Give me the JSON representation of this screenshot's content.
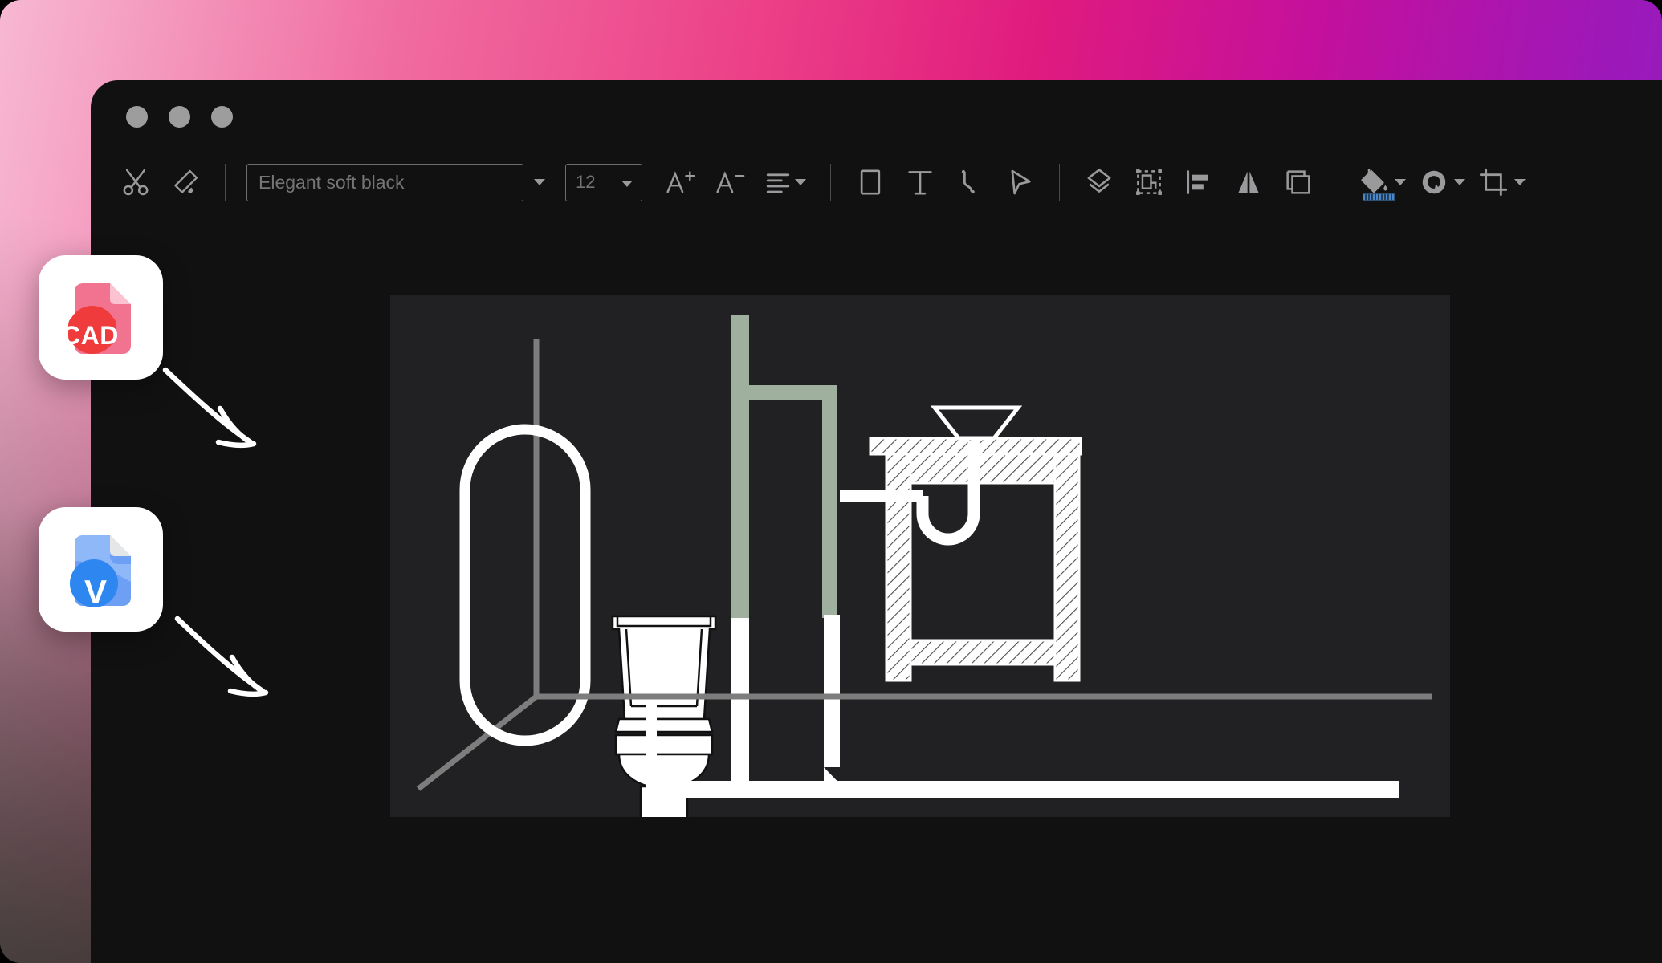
{
  "window": {
    "traffic_lights": [
      "close",
      "minimize",
      "maximize"
    ]
  },
  "toolbar": {
    "cut_label": "Cut",
    "format_painter_label": "Format Painter",
    "font_name": "Elegant soft black",
    "font_name_placeholder": "Elegant soft black",
    "font_name_dropdown_label": "Font list",
    "font_size": "12",
    "font_size_placeholder": "12",
    "font_size_dropdown_label": "Size list",
    "increase_font_label": "Increase font size",
    "decrease_font_label": "Decrease font size",
    "align_label": "Text alignment",
    "rectangle_label": "Rectangle",
    "text_label": "Text",
    "polyline_label": "Polyline",
    "select_label": "Select",
    "layers_label": "Layers",
    "group_label": "Group objects",
    "align_left_label": "Align left",
    "mirror_label": "Mirror",
    "frame_label": "Frame",
    "fill_label": "Fill color",
    "shape_fill_label": "Shape fill",
    "crop_label": "Crop",
    "fill_swatch_color": "#4a86c8",
    "icon_color": "#9a9a9c"
  },
  "cards": [
    {
      "name": "cad-file",
      "badge_text": "CAD",
      "doc_color": "#f2738f",
      "doc_color_light": "#f8b7c6",
      "badge_color": "#ef3b3b",
      "card_background": "#ffffff"
    },
    {
      "name": "visio-file",
      "badge_text": "V",
      "doc_color": "#6d9ff5",
      "doc_color_light": "#a9c7fb",
      "badge_color": "#2e86f0",
      "card_background": "#ffffff"
    }
  ],
  "canvas": {
    "background": "#212123",
    "drawing_title": "Bathroom plumbing CAD drawing",
    "stroke_white": "#ffffff",
    "stroke_green": "#9fb09e",
    "axis_color": "#7d7d7d",
    "objects": [
      "bathtub-outline",
      "toilet-elevation",
      "green-pipe-riser",
      "sink-cabinet-section",
      "p-trap",
      "funnel-basin",
      "drain-line",
      "isometric-axes"
    ]
  },
  "backdrop": {
    "gradient_start": "#f7b8d2",
    "gradient_mid": "#e01b7e",
    "gradient_end": "#8a1fc4"
  }
}
